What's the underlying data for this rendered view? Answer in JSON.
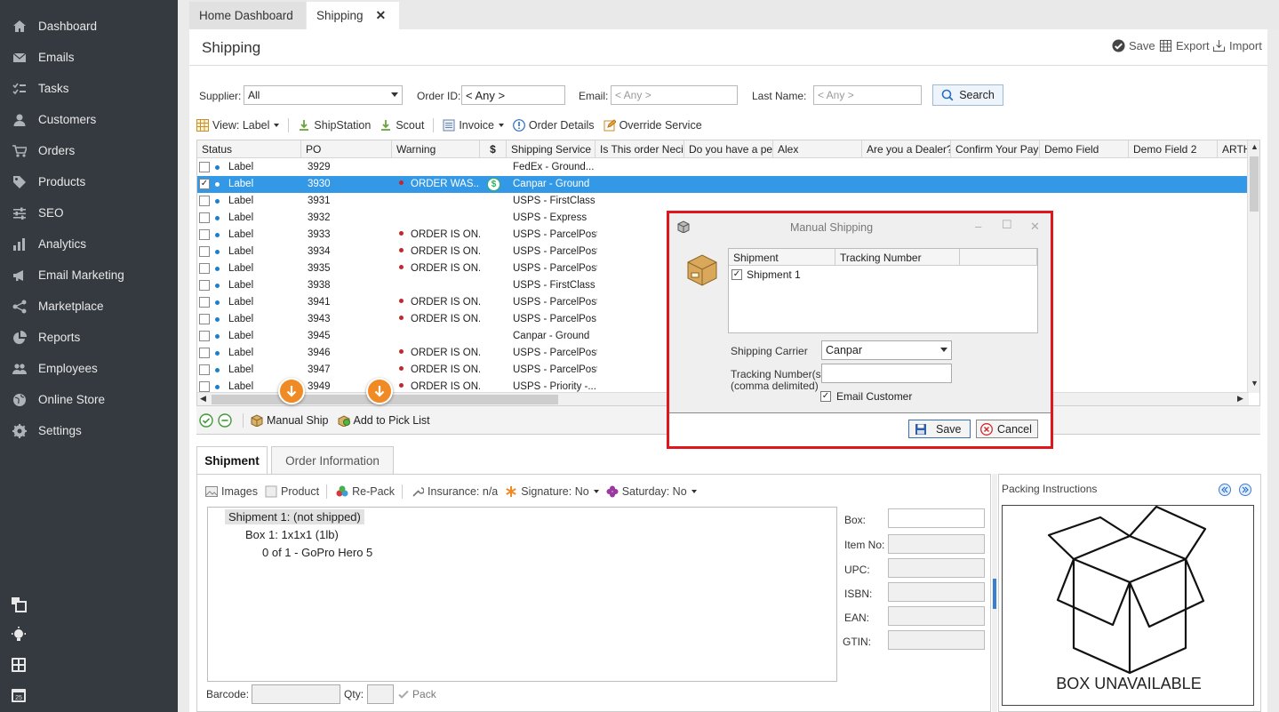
{
  "sidebar": {
    "items": [
      {
        "label": "Dashboard",
        "icon": "home-icon"
      },
      {
        "label": "Emails",
        "icon": "envelope-icon"
      },
      {
        "label": "Tasks",
        "icon": "tasks-icon"
      },
      {
        "label": "Customers",
        "icon": "user-icon"
      },
      {
        "label": "Orders",
        "icon": "cart-icon"
      },
      {
        "label": "Products",
        "icon": "tag-icon"
      },
      {
        "label": "SEO",
        "icon": "sliders-icon"
      },
      {
        "label": "Analytics",
        "icon": "bar-chart-icon"
      },
      {
        "label": "Email Marketing",
        "icon": "megaphone-icon"
      },
      {
        "label": "Marketplace",
        "icon": "share-icon"
      },
      {
        "label": "Reports",
        "icon": "pie-chart-icon"
      },
      {
        "label": "Employees",
        "icon": "users-icon"
      },
      {
        "label": "Online Store",
        "icon": "globe-icon"
      },
      {
        "label": "Settings",
        "icon": "gear-icon"
      }
    ],
    "bottom_icons": [
      "windows-icon",
      "lightbulb-icon",
      "calculator-icon",
      "calendar-icon"
    ],
    "calendar_day": "25"
  },
  "tabs": [
    {
      "label": "Home Dashboard"
    },
    {
      "label": "Shipping",
      "close": "✕"
    }
  ],
  "header": {
    "title": "Shipping",
    "save": "Save",
    "export": "Export",
    "import": "Import"
  },
  "filters": {
    "supplier_label": "Supplier:",
    "supplier_value": "All",
    "order_id_label": "Order ID:",
    "order_id_value": "< Any >",
    "email_label": "Email:",
    "email_placeholder": "< Any >",
    "last_name_label": "Last Name:",
    "last_name_placeholder": "< Any >",
    "search_label": "Search"
  },
  "toolbar": {
    "view_label": "View: Label",
    "shipstation": "ShipStation",
    "scout": "Scout",
    "invoice": "Invoice",
    "order_details": "Order Details",
    "override_service": "Override Service"
  },
  "grid": {
    "columns": [
      "Status",
      "PO",
      "Warning",
      "$",
      "Shipping Service",
      "Is This order Neci",
      "Do you have a pe",
      "Alex",
      "Are you a Dealer?",
      "Confirm Your Pay",
      "Demo Field",
      "Demo Field 2",
      "ARTH"
    ],
    "rows": [
      {
        "status": "Label",
        "po": "3929",
        "warning": "",
        "service": "FedEx - Ground...",
        "selected": false
      },
      {
        "status": "Label",
        "po": "3930",
        "warning": "ORDER WAS...",
        "service": "Canpar - Ground",
        "selected": true,
        "dollar": "$"
      },
      {
        "status": "Label",
        "po": "3931",
        "warning": "",
        "service": "USPS - FirstClass",
        "selected": false
      },
      {
        "status": "Label",
        "po": "3932",
        "warning": "",
        "service": "USPS - Express",
        "selected": false
      },
      {
        "status": "Label",
        "po": "3933",
        "warning": "ORDER IS ON...",
        "service": "USPS - ParcelPost",
        "selected": false
      },
      {
        "status": "Label",
        "po": "3934",
        "warning": "ORDER IS ON...",
        "service": "USPS - ParcelPost",
        "selected": false
      },
      {
        "status": "Label",
        "po": "3935",
        "warning": "ORDER IS ON...",
        "service": "USPS - ParcelPost",
        "selected": false
      },
      {
        "status": "Label",
        "po": "3938",
        "warning": "",
        "service": "USPS - FirstClass",
        "selected": false
      },
      {
        "status": "Label",
        "po": "3941",
        "warning": "ORDER IS ON...",
        "service": "USPS - ParcelPost",
        "selected": false
      },
      {
        "status": "Label",
        "po": "3943",
        "warning": "ORDER IS ON...",
        "service": "USPS - ParcelPos...",
        "selected": false
      },
      {
        "status": "Label",
        "po": "3945",
        "warning": "",
        "service": "Canpar - Ground",
        "selected": false
      },
      {
        "status": "Label",
        "po": "3946",
        "warning": "ORDER IS ON...",
        "service": "USPS - ParcelPost",
        "selected": false
      },
      {
        "status": "Label",
        "po": "3947",
        "warning": "ORDER IS ON...",
        "service": "USPS - ParcelPost",
        "selected": false
      },
      {
        "status": "Label",
        "po": "3949",
        "warning": "ORDER IS ON...",
        "service": "USPS - Priority -...",
        "selected": false
      }
    ]
  },
  "bottombar": {
    "manual_ship": "Manual Ship",
    "add_to_pick_list": "Add to Pick List"
  },
  "shipment_tabs": [
    {
      "label": "Shipment"
    },
    {
      "label": "Order Information"
    }
  ],
  "shipment_toolbar": {
    "images": "Images",
    "product": "Product",
    "repack": "Re-Pack",
    "insurance": "Insurance: n/a",
    "signature": "Signature: No",
    "saturday": "Saturday: No"
  },
  "tree": {
    "shipment": "Shipment 1: (not shipped)",
    "box": "Box 1: 1x1x1 (1lb)",
    "item": "0 of 1 - GoPro Hero 5"
  },
  "product_fields": {
    "box": "Box:",
    "item_no": "Item No:",
    "upc": "UPC:",
    "isbn": "ISBN:",
    "ean": "EAN:",
    "gtin": "GTIN:"
  },
  "barcode": {
    "barcode_label": "Barcode:",
    "qty_label": "Qty:",
    "pack_label": "Pack"
  },
  "packing": {
    "title": "Packing Instructions",
    "box_text": "BOX UNAVAILABLE"
  },
  "dialog": {
    "title": "Manual Shipping",
    "minimize": "–",
    "maximize": "☐",
    "close": "✕",
    "grid_headers": [
      "Shipment",
      "Tracking Number"
    ],
    "shipment_row": "Shipment 1",
    "carrier_label": "Shipping Carrier",
    "carrier_value": "Canpar",
    "tracking_label_1": "Tracking Number(s)",
    "tracking_label_2": "(comma delimited)",
    "email_customer": "Email Customer",
    "save": "Save",
    "cancel": "Cancel"
  },
  "colors": {
    "sidebar_bg": "#353a40",
    "selected_row": "#3399e6",
    "accent_orange": "#f08a24",
    "dialog_border": "#e0161c"
  }
}
